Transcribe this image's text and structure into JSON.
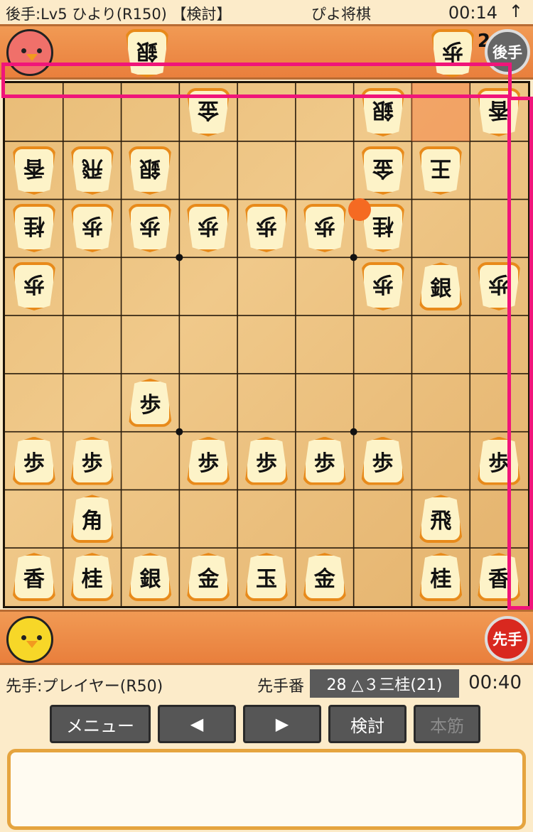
{
  "status_bar": {
    "left": "後手:Lv5 ひより(R150) 【検討】",
    "app_name": "ぴよ将棋",
    "clock": "00:14",
    "arrow": "↑"
  },
  "gote_stand": {
    "hand_count": "2",
    "turn_label": "後手",
    "hand_pieces": [
      "銀",
      "歩"
    ]
  },
  "sente_stand": {
    "turn_label": "先手"
  },
  "board": {
    "pieces": [
      {
        "row": 0,
        "col": 3,
        "glyph": "金",
        "side": "gote"
      },
      {
        "row": 0,
        "col": 6,
        "glyph": "銀",
        "side": "gote"
      },
      {
        "row": 0,
        "col": 8,
        "glyph": "香",
        "side": "gote"
      },
      {
        "row": 1,
        "col": 0,
        "glyph": "香",
        "side": "gote"
      },
      {
        "row": 1,
        "col": 1,
        "glyph": "飛",
        "side": "gote"
      },
      {
        "row": 1,
        "col": 2,
        "glyph": "銀",
        "side": "gote"
      },
      {
        "row": 1,
        "col": 6,
        "glyph": "金",
        "side": "gote"
      },
      {
        "row": 1,
        "col": 7,
        "glyph": "王",
        "side": "gote"
      },
      {
        "row": 2,
        "col": 0,
        "glyph": "桂",
        "side": "gote"
      },
      {
        "row": 2,
        "col": 1,
        "glyph": "歩",
        "side": "gote"
      },
      {
        "row": 2,
        "col": 2,
        "glyph": "歩",
        "side": "gote"
      },
      {
        "row": 2,
        "col": 3,
        "glyph": "歩",
        "side": "gote"
      },
      {
        "row": 2,
        "col": 4,
        "glyph": "歩",
        "side": "gote"
      },
      {
        "row": 2,
        "col": 5,
        "glyph": "歩",
        "side": "gote"
      },
      {
        "row": 2,
        "col": 6,
        "glyph": "桂",
        "side": "gote"
      },
      {
        "row": 3,
        "col": 0,
        "glyph": "歩",
        "side": "gote"
      },
      {
        "row": 3,
        "col": 6,
        "glyph": "歩",
        "side": "gote"
      },
      {
        "row": 3,
        "col": 7,
        "glyph": "銀",
        "side": "sente"
      },
      {
        "row": 3,
        "col": 8,
        "glyph": "歩",
        "side": "gote"
      },
      {
        "row": 5,
        "col": 2,
        "glyph": "歩",
        "side": "sente"
      },
      {
        "row": 6,
        "col": 0,
        "glyph": "歩",
        "side": "sente"
      },
      {
        "row": 6,
        "col": 1,
        "glyph": "歩",
        "side": "sente"
      },
      {
        "row": 6,
        "col": 3,
        "glyph": "歩",
        "side": "sente"
      },
      {
        "row": 6,
        "col": 4,
        "glyph": "歩",
        "side": "sente"
      },
      {
        "row": 6,
        "col": 5,
        "glyph": "歩",
        "side": "sente"
      },
      {
        "row": 6,
        "col": 6,
        "glyph": "歩",
        "side": "sente"
      },
      {
        "row": 6,
        "col": 8,
        "glyph": "歩",
        "side": "sente"
      },
      {
        "row": 7,
        "col": 1,
        "glyph": "角",
        "side": "sente"
      },
      {
        "row": 7,
        "col": 7,
        "glyph": "飛",
        "side": "sente"
      },
      {
        "row": 8,
        "col": 0,
        "glyph": "香",
        "side": "sente"
      },
      {
        "row": 8,
        "col": 1,
        "glyph": "桂",
        "side": "sente"
      },
      {
        "row": 8,
        "col": 2,
        "glyph": "銀",
        "side": "sente"
      },
      {
        "row": 8,
        "col": 3,
        "glyph": "金",
        "side": "sente"
      },
      {
        "row": 8,
        "col": 4,
        "glyph": "玉",
        "side": "sente"
      },
      {
        "row": 8,
        "col": 5,
        "glyph": "金",
        "side": "sente"
      },
      {
        "row": 8,
        "col": 7,
        "glyph": "桂",
        "side": "sente"
      },
      {
        "row": 8,
        "col": 8,
        "glyph": "香",
        "side": "sente"
      }
    ],
    "highlight_square": {
      "row": 0,
      "col": 7
    },
    "last_move_marker": {
      "row": 2,
      "col": 6
    }
  },
  "info": {
    "player": "先手:プレイヤー(R50)",
    "turn": "先手番",
    "last_move": "28 △３三桂(21)",
    "time": "00:40"
  },
  "buttons": {
    "menu": "メニュー",
    "prev": "◀",
    "next": "▶",
    "analyze": "検討",
    "mainline": "本筋"
  },
  "colors": {
    "piece_border": "#e88a1a",
    "stand": "#ec8b47",
    "overlay": "#f0157a"
  }
}
